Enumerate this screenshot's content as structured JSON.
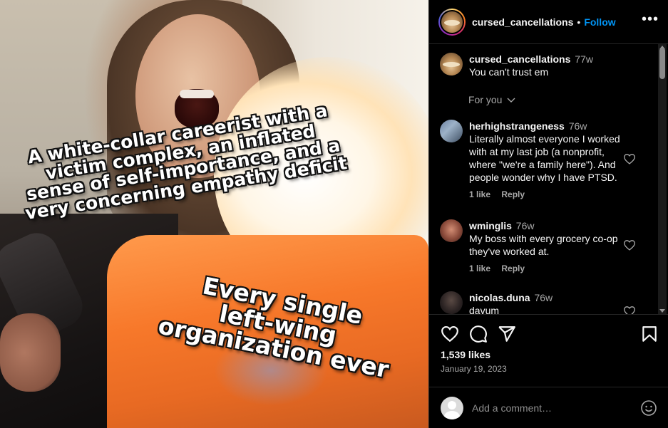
{
  "media": {
    "caption_top": "A white-collar careerist with a\nvictim complex, an inflated\nsense of self-importance, and a\nvery concerning empathy deficit",
    "caption_bottom": "Every single\nleft-wing\norganization ever"
  },
  "header": {
    "username": "cursed_cancellations",
    "separator": "•",
    "follow_label": "Follow",
    "more_label": "•••"
  },
  "post_caption": {
    "username": "cursed_cancellations",
    "time": "77w",
    "text": "You can't trust em"
  },
  "for_you_label": "For you",
  "comments": [
    {
      "username": "herhighstrangeness",
      "time": "76w",
      "text": "Literally almost everyone I worked with at my last job (a nonprofit, where \"we're a family here\"). And people wonder why I have PTSD.",
      "likes": "1 like",
      "reply": "Reply"
    },
    {
      "username": "wminglis",
      "time": "76w",
      "text": "My boss with every grocery co-op they've worked at.",
      "likes": "1 like",
      "reply": "Reply"
    },
    {
      "username": "nicolas.duna",
      "time": "76w",
      "text": "davum",
      "likes": "",
      "reply": ""
    }
  ],
  "actions": {
    "likes_count": "1,539 likes",
    "date": "January 19, 2023"
  },
  "add_comment": {
    "placeholder": "Add a comment…"
  },
  "icons": {
    "more": "more-icon",
    "heart": "heart-icon",
    "comment": "comment-icon",
    "share": "share-icon",
    "save": "bookmark-icon",
    "emoji": "emoji-icon",
    "chevron": "chevron-down-icon"
  },
  "colors": {
    "background": "#000000",
    "text": "#f5f5f5",
    "secondary_text": "#a8a8a8",
    "follow_blue": "#0095f6",
    "divider": "#262626"
  }
}
